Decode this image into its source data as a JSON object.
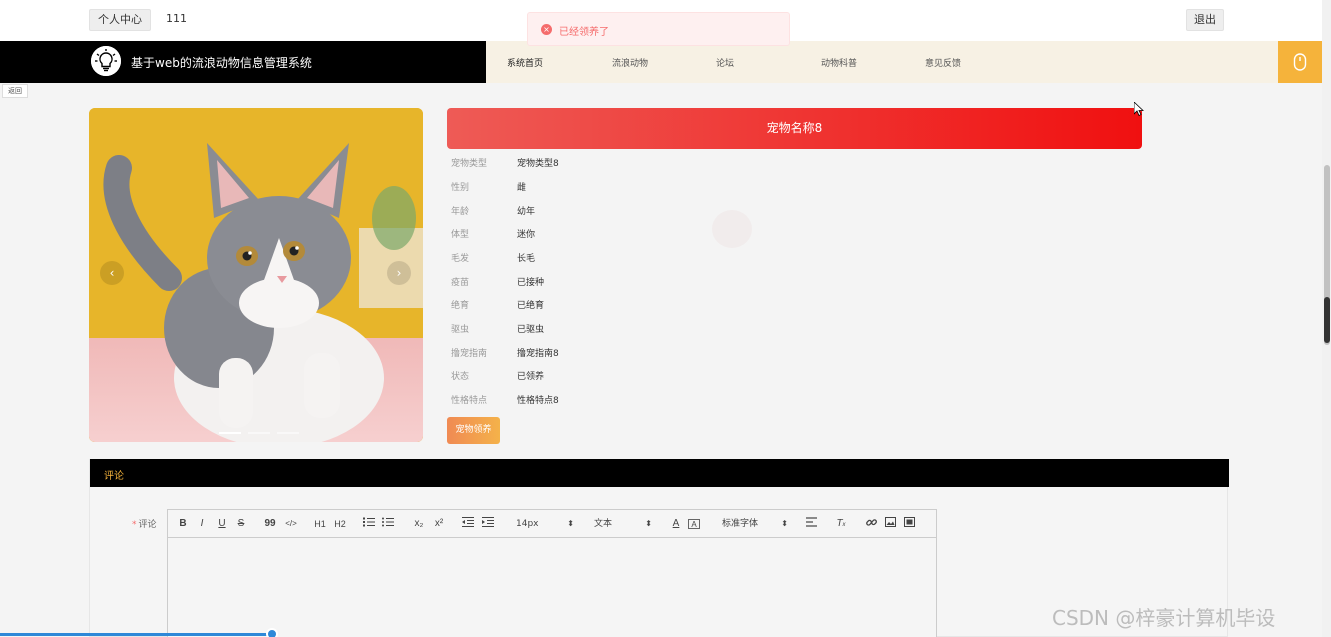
{
  "topbar": {
    "user_center_label": "个人中心",
    "username": "111",
    "logout_label": "退出"
  },
  "toast": {
    "message": "已经领养了",
    "icon": "close-circle-icon",
    "color": "#f56c6c"
  },
  "navbar": {
    "brand_title": "基于web的流浪动物信息管理系统",
    "logo_icon": "lightbulb-icon",
    "items": [
      {
        "label": "系统首页",
        "active": true
      },
      {
        "label": "流浪动物",
        "active": false
      },
      {
        "label": "论坛",
        "active": false
      },
      {
        "label": "动物科普",
        "active": false
      },
      {
        "label": "意见反馈",
        "active": false
      }
    ],
    "side_button_icon": "mouse-icon",
    "accent_color": "#f5b33b"
  },
  "back_label": "返回",
  "pet": {
    "title": "宠物名称8",
    "attributes": [
      {
        "label": "宠物类型",
        "value": "宠物类型8"
      },
      {
        "label": "性别",
        "value": "雌"
      },
      {
        "label": "年龄",
        "value": "幼年"
      },
      {
        "label": "体型",
        "value": "迷你"
      },
      {
        "label": "毛发",
        "value": "长毛"
      },
      {
        "label": "疫苗",
        "value": "已接种"
      },
      {
        "label": "绝育",
        "value": "已绝育"
      },
      {
        "label": "驱虫",
        "value": "已驱虫"
      },
      {
        "label": "撸宠指南",
        "value": "撸宠指南8"
      },
      {
        "label": "状态",
        "value": "已领养"
      },
      {
        "label": "性格特点",
        "value": "性格特点8"
      }
    ],
    "adopt_button": "宠物领养"
  },
  "carousel": {
    "prev_icon": "chevron-left-icon",
    "next_icon": "chevron-right-icon",
    "prev_glyph": "‹",
    "next_glyph": "›",
    "slide_count": 3,
    "active_index": 0
  },
  "comments": {
    "header": "评论",
    "field_label": "评论",
    "required_mark": "*",
    "toolbar": {
      "buttons": [
        "B",
        "I",
        "U",
        "S",
        "99",
        "</>",
        "H1",
        "H2",
        "ordered-list",
        "bullet-list",
        "x₂",
        "x²",
        "outdent",
        "indent",
        "font-color",
        "background-color",
        "align",
        "clear-format",
        "link",
        "image",
        "video"
      ],
      "font_size": "14px",
      "text_type": "文本",
      "font_family": "标准字体"
    }
  },
  "watermark": "CSDN @梓豪计算机毕设"
}
